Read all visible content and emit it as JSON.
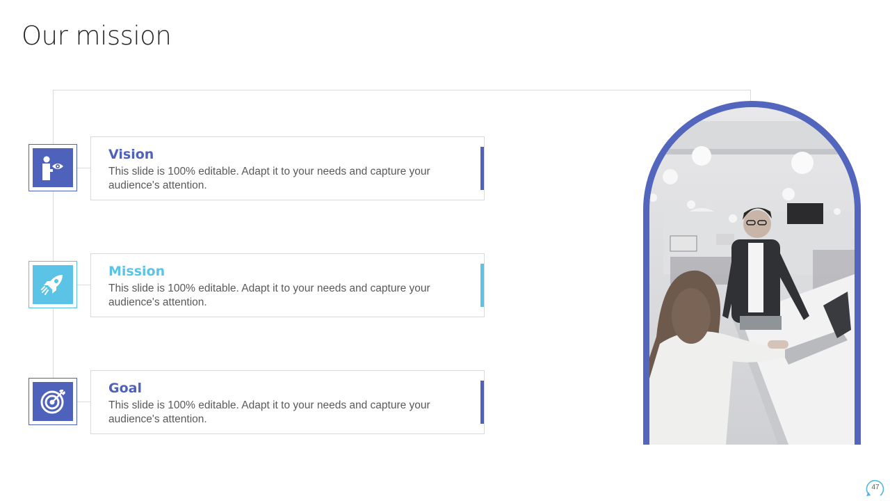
{
  "slide": {
    "title": "Our mission",
    "page_number": "47"
  },
  "items": [
    {
      "title": "Vision",
      "text": "This slide is 100% editable. Adapt it to your  needs and capture your audience's attention.",
      "icon": "person-eye-icon",
      "color": "#4e62bb"
    },
    {
      "title": "Mission",
      "text": "This slide is 100% editable. Adapt it to your  needs and capture your audience's attention.",
      "icon": "rocket-icon",
      "color": "#5bc4e6"
    },
    {
      "title": "Goal",
      "text": "This slide is 100% editable. Adapt it to your  needs and capture your audience's attention.",
      "icon": "target-icon",
      "color": "#4e62bb"
    }
  ],
  "photo": {
    "subject": "office-meeting-photo",
    "frame_color": "#5166bc"
  }
}
